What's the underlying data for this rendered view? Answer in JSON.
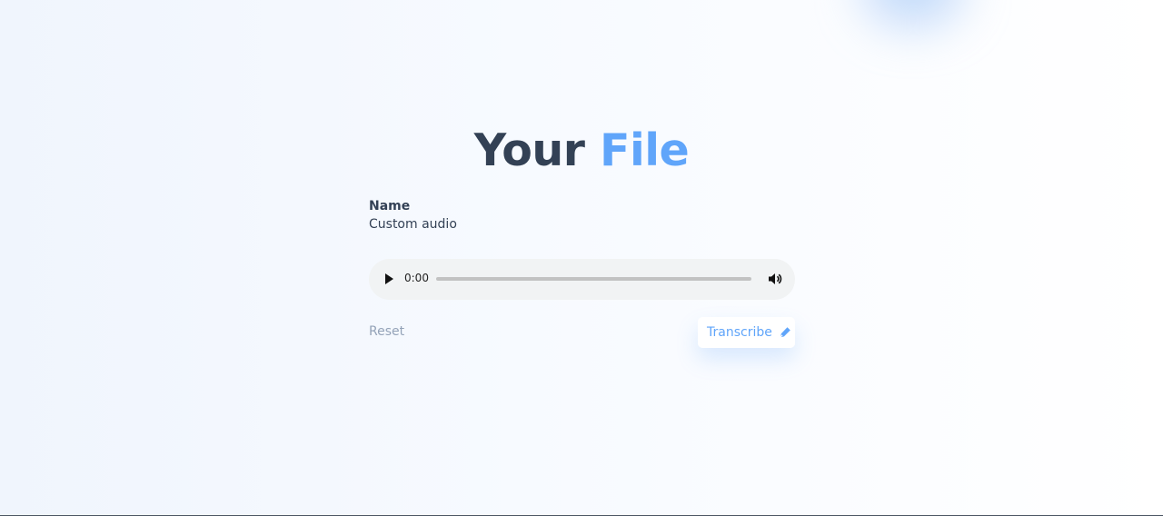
{
  "page": {
    "title_part1": "Your",
    "title_part2": "File",
    "accent_color": "#60a5fa",
    "text_color": "#334155"
  },
  "file": {
    "name_label": "Name",
    "name_value": "Custom audio"
  },
  "audio": {
    "current_time": "0:00",
    "progress": 0,
    "icons": [
      "play-icon",
      "volume-icon"
    ]
  },
  "actions": {
    "reset_label": "Reset",
    "transcribe_label": "Transcribe",
    "transcribe_icon": "pen-icon"
  }
}
